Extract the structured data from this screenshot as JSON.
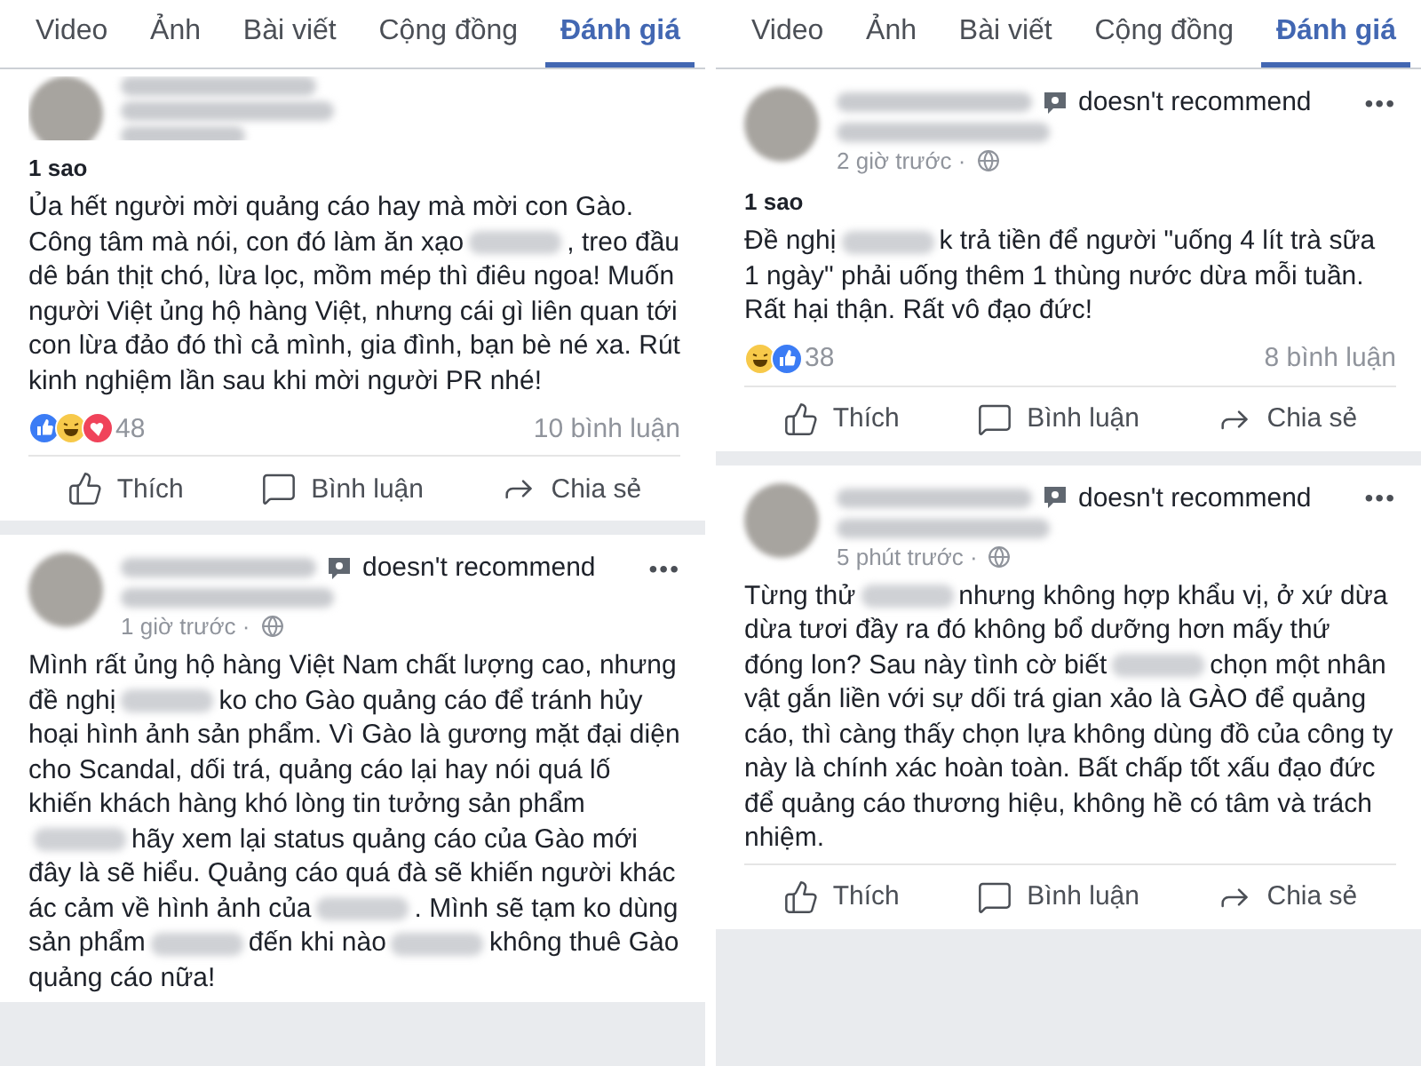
{
  "panels": [
    {
      "tabs": [
        {
          "label": "Video",
          "selected": false
        },
        {
          "label": "Ảnh",
          "selected": false
        },
        {
          "label": "Bài viết",
          "selected": false
        },
        {
          "label": "Cộng đồng",
          "selected": false
        },
        {
          "label": "Đánh giá",
          "selected": true
        }
      ],
      "reviews": [
        {
          "cut_top": true,
          "rating": "1 sao",
          "body": [
            {
              "kind": "text",
              "text": "Ủa hết người mời quảng cáo hay mà mời con Gào. Công tâm mà nói, con đó làm ăn xạo"
            },
            {
              "kind": "blur"
            },
            {
              "kind": "text",
              "text": ", treo đầu dê bán thịt chó, lừa lọc, mồm mép thì điêu ngoa! Muốn người Việt ủng hộ hàng Việt, nhưng cái gì liên quan tới con lừa đảo đó thì cả mình, gia đình, bạn bè né xa. Rút kinh nghiệm lần sau khi mời người PR nhé!"
            }
          ],
          "reactions": [
            {
              "kind": "like"
            },
            {
              "kind": "haha"
            },
            {
              "kind": "love"
            }
          ],
          "reaction_count": "48",
          "comments": "10 bình luận",
          "actions": [
            {
              "kind": "like",
              "label": "Thích"
            },
            {
              "kind": "comment",
              "label": "Bình luận"
            },
            {
              "kind": "share",
              "label": "Chia sẻ"
            }
          ]
        },
        {
          "cut_top": false,
          "verdict": "doesn't recommend",
          "more": "•••",
          "time": "1 giờ trước ·",
          "body": [
            {
              "kind": "text",
              "text": "Mình rất ủng hộ hàng Việt Nam chất lượng cao, nhưng đề nghị"
            },
            {
              "kind": "blur"
            },
            {
              "kind": "text",
              "text": "ko cho Gào quảng cáo để tránh hủy hoại hình ảnh sản phẩm. Vì Gào là gương mặt đại diện cho Scandal, dối trá, quảng cáo lại hay nói quá lố khiến khách hàng khó lòng tin tưởng sản phẩm"
            },
            {
              "kind": "blur"
            },
            {
              "kind": "text",
              "text": "hãy xem lại status quảng cáo của Gào mới đây là sẽ hiểu. Quảng cáo quá đà sẽ khiến người khác ác cảm về hình ảnh của"
            },
            {
              "kind": "blur"
            },
            {
              "kind": "text",
              "text": ". Mình sẽ tạm ko dùng sản phẩm"
            },
            {
              "kind": "blur"
            },
            {
              "kind": "text",
              "text": "đến khi nào"
            },
            {
              "kind": "blur"
            },
            {
              "kind": "text",
              "text": "không thuê Gào quảng cáo nữa!"
            }
          ]
        }
      ]
    },
    {
      "tabs": [
        {
          "label": "Video",
          "selected": false
        },
        {
          "label": "Ảnh",
          "selected": false
        },
        {
          "label": "Bài viết",
          "selected": false
        },
        {
          "label": "Cộng đồng",
          "selected": false
        },
        {
          "label": "Đánh giá",
          "selected": true
        }
      ],
      "reviews": [
        {
          "cut_top": false,
          "verdict": "doesn't recommend",
          "more": "•••",
          "time": "2 giờ trước ·",
          "rating": "1 sao",
          "body": [
            {
              "kind": "text",
              "text": "Đề nghị"
            },
            {
              "kind": "blur"
            },
            {
              "kind": "text",
              "text": "k trả tiền để người \"uống 4 lít trà sữa 1 ngày\" phải uống thêm 1 thùng nước dừa mỗi tuần. Rất hại thận. Rất vô đạo đức!"
            }
          ],
          "reactions": [
            {
              "kind": "haha"
            },
            {
              "kind": "like"
            }
          ],
          "reaction_count": "38",
          "comments": "8 bình luận",
          "actions": [
            {
              "kind": "like",
              "label": "Thích"
            },
            {
              "kind": "comment",
              "label": "Bình luận"
            },
            {
              "kind": "share",
              "label": "Chia sẻ"
            }
          ]
        },
        {
          "cut_top": false,
          "verdict": "doesn't recommend",
          "more": "•••",
          "time": "5 phút trước ·",
          "body": [
            {
              "kind": "text",
              "text": "Từng thử"
            },
            {
              "kind": "blur"
            },
            {
              "kind": "text",
              "text": "nhưng không hợp khẩu vị, ở xứ dừa dừa tươi đầy ra đó không bổ dưỡng hơn mấy thứ đóng lon? Sau này tình cờ biết"
            },
            {
              "kind": "blur"
            },
            {
              "kind": "text",
              "text": "chọn một nhân vật gắn liền với sự dối trá gian xảo là GÀO để quảng cáo, thì càng thấy chọn lựa không dùng đồ của công ty này là chính xác hoàn toàn. Bất chấp tốt xấu đạo đức để quảng cáo thương hiệu, không hề có tâm và trách nhiệm."
            }
          ],
          "actions": [
            {
              "kind": "like",
              "label": "Thích"
            },
            {
              "kind": "comment",
              "label": "Bình luận"
            },
            {
              "kind": "share",
              "label": "Chia sẻ"
            }
          ]
        }
      ]
    }
  ]
}
